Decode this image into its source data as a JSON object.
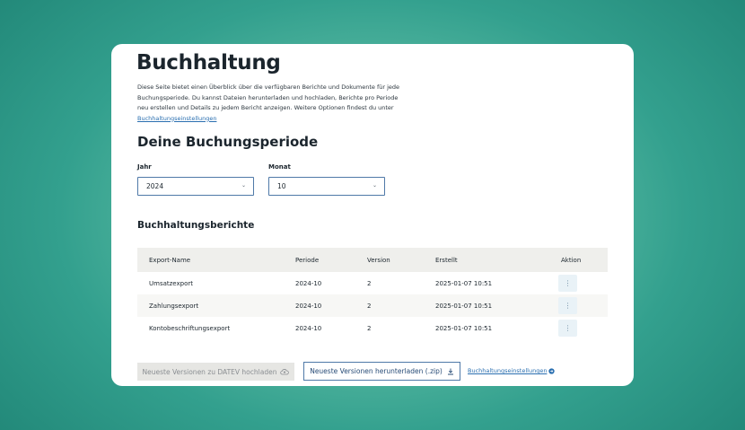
{
  "page": {
    "title": "Buchhaltung",
    "intro_text": "Diese Seite bietet einen Überblick über die verfügbaren Berichte und Dokumente für jede Buchungsperiode. Du kannst Dateien herunterladen und hochladen, Berichte pro Periode neu erstellen und Details zu jedem Bericht anzeigen. Weitere Optionen findest du unter",
    "intro_link": "Buchhaltungseinstellungen"
  },
  "period": {
    "heading": "Deine Buchungsperiode",
    "year_label": "Jahr",
    "year_value": "2024",
    "month_label": "Monat",
    "month_value": "10"
  },
  "reports": {
    "heading": "Buchhaltungsberichte",
    "columns": [
      "Export-Name",
      "Periode",
      "Version",
      "Erstellt",
      "Aktion"
    ],
    "rows": [
      {
        "name": "Umsatzexport",
        "period": "2024-10",
        "version": "2",
        "created": "2025-01-07 10:51",
        "action": "⋮"
      },
      {
        "name": "Zahlungsexport",
        "period": "2024-10",
        "version": "2",
        "created": "2025-01-07 10:51",
        "action": "⋮"
      },
      {
        "name": "Kontobeschriftungsexport",
        "period": "2024-10",
        "version": "2",
        "created": "2025-01-07 10:51",
        "action": "⋮"
      }
    ]
  },
  "actions": {
    "upload_label": "Neueste Versionen zu DATEV hochladen",
    "download_label": "Neueste Versionen herunterladen (.zip)",
    "settings_link": "Buchhaltungseinstellungen"
  },
  "icons": {
    "upload": "cloud-upload-icon",
    "download": "download-icon",
    "settings": "arrow-circle-icon",
    "select": "chevron-down-icon",
    "row_action": "more-vertical-icon"
  },
  "colors": {
    "accent": "#4f79a8",
    "link": "#2a6fb0",
    "header_bg": "#efefec",
    "background_mint": "#5cbca4",
    "background_teal": "#1f8475"
  }
}
